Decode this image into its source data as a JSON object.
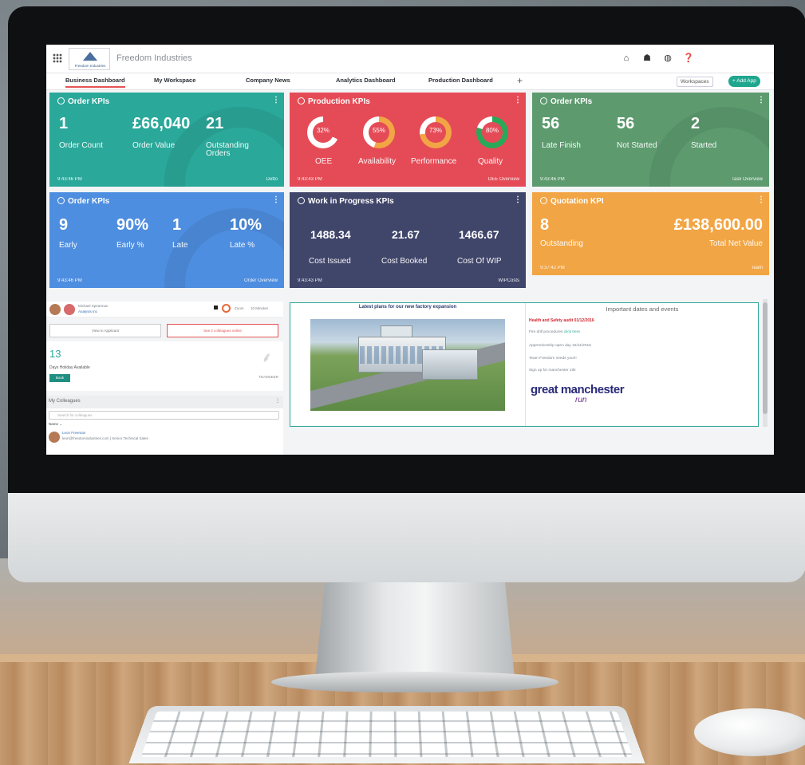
{
  "topbar": {
    "logo_text": "Freedom Industries",
    "company": "Freedom Industries",
    "icons": [
      "home-icon",
      "people-icon",
      "globe-icon",
      "help-icon"
    ]
  },
  "tabs": [
    {
      "label": "Business Dashboard",
      "active": true
    },
    {
      "label": "My Workspace"
    },
    {
      "label": "Company News"
    },
    {
      "label": "Analytics Dashboard"
    },
    {
      "label": "Production Dashboard"
    }
  ],
  "tab_add": "+",
  "actions": {
    "workspaces": "Workspaces",
    "add_app": "+ Add App"
  },
  "cards": {
    "order1": {
      "title": "Order KPIs",
      "menu": "⋮",
      "v1": "1",
      "l1": "Order Count",
      "v2": "£66,040",
      "l2": "Order Value",
      "v3": "21",
      "l3": "Outstanding Orders",
      "time": "9:43:46 PM",
      "link": "Detto"
    },
    "production": {
      "title": "Production KPIs",
      "menu": "⋮",
      "donuts": [
        {
          "pct": "32%",
          "value": 32,
          "label": "OEE",
          "color": "#e54b56"
        },
        {
          "pct": "55%",
          "value": 55,
          "label": "Availability",
          "color": "#f2a544"
        },
        {
          "pct": "73%",
          "value": 73,
          "label": "Performance",
          "color": "#f2a544"
        },
        {
          "pct": "80%",
          "value": 80,
          "label": "Quality",
          "color": "#2aa85a"
        }
      ],
      "time": "9:43:43 PM",
      "link": "OEE Overview"
    },
    "order3": {
      "title": "Order KPIs",
      "menu": "⋮",
      "v1": "56",
      "l1": "Late Finish",
      "v2": "56",
      "l2": "Not Started",
      "v3": "2",
      "l3": "Started",
      "time": "9:43:46 PM",
      "link": "Task Overview"
    },
    "order2": {
      "title": "Order KPIs",
      "menu": "⋮",
      "v1": "9",
      "l1": "Early",
      "v2": "90%",
      "l2": "Early %",
      "v3": "1",
      "l3": "Late",
      "v4": "10%",
      "l4": "Late %",
      "time": "9:43:46 PM",
      "link": "Order Overview"
    },
    "wip": {
      "title": "Work in Progress KPIs",
      "menu": "⋮",
      "v1": "1488.34",
      "l1": "Cost Issued",
      "v2": "21.67",
      "l2": "Cost Booked",
      "v3": "1466.67",
      "l3": "Cost Of WIP",
      "time": "9:43:43 PM",
      "link": "WIPCosts"
    },
    "quote": {
      "title": "Quotation KPI",
      "menu": "⋮",
      "v1": "8",
      "l1": "Outstanding",
      "v2": "£138,600.00",
      "l2": "Total Net Value",
      "time": "9:37:42 PM",
      "link": "Team"
    }
  },
  "lower_left": {
    "person_name": "Michael Spearman",
    "person_sub": "Analysis Inc",
    "status1": "Zoom",
    "status2": "10 Minutes",
    "btn_left": "View in Applicant",
    "btn_right": "See 2 colleagues online",
    "holiday_count": "13",
    "holiday_label": "Days Holiday Available",
    "holiday_btn": "Book",
    "holiday_src": "TEAMSEER",
    "colleagues_title": "My Colleagues",
    "colleagues_menu": "⋮",
    "search_placeholder": "Search for colleagues",
    "name_header": "Name ⌄",
    "colleague_name": "Leon Freeman",
    "colleague_detail": "leon@freedomindustries.com | Senior Technical Sales"
  },
  "news": {
    "left_title": "Latest plans for our new factory expansion",
    "right_title": "Important dates and events",
    "alert": "Health and Safety audit 01/12/2016",
    "items": [
      {
        "pre": "Fire drill procedures ",
        "link": "click here"
      },
      {
        "pre": "Apprenticeship open day 15/11/2016",
        "link": ""
      },
      {
        "pre": "Team Freedom needs you!!!",
        "link": ""
      },
      {
        "pre": "Sign up for manchester 10k",
        "link": ""
      }
    ],
    "logo_main": "great manchester",
    "logo_sub": "run"
  }
}
